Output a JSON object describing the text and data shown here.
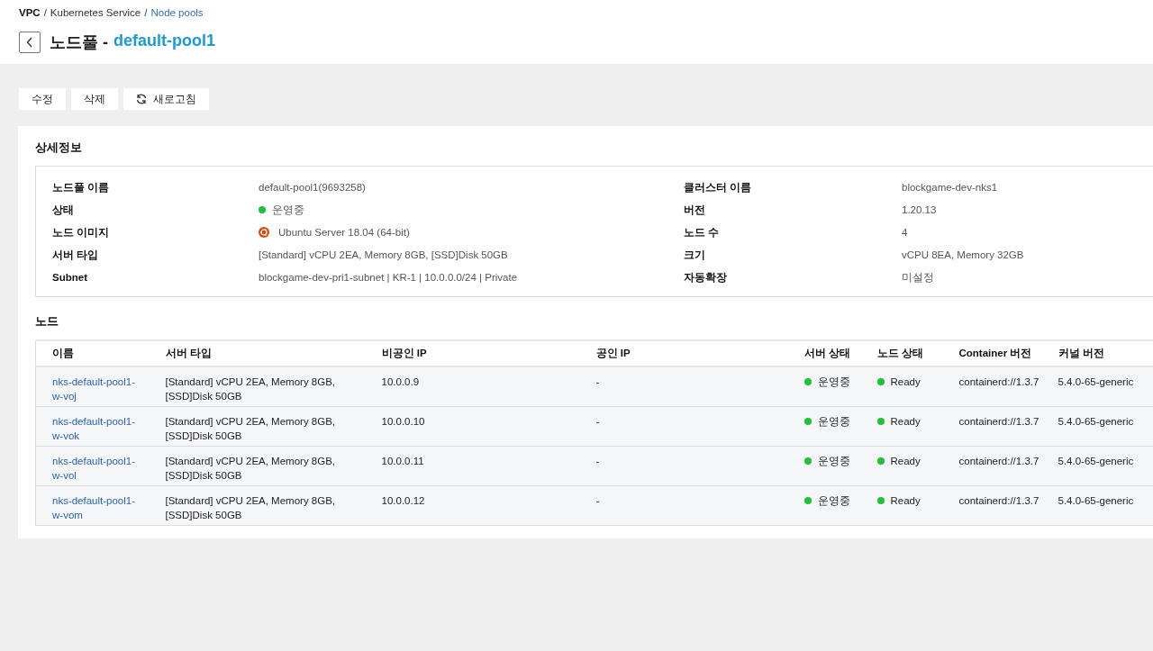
{
  "breadcrumb": [
    {
      "label": "VPC",
      "kind": "root",
      "separator": "/"
    },
    {
      "label": "Kubernetes Service",
      "kind": "text",
      "separator": "/"
    },
    {
      "label": "Node pools",
      "kind": "link"
    }
  ],
  "title": {
    "prefix": "노드풀 -",
    "name": "default-pool1"
  },
  "toolbar": [
    {
      "label": "수정",
      "kind": "plain"
    },
    {
      "label": "삭제",
      "kind": "plain"
    },
    {
      "label": "새로고침",
      "kind": "refresh"
    }
  ],
  "details": {
    "title": "상세정보",
    "left": [
      {
        "label": "노드풀 이름",
        "value": "default-pool1(9693258)",
        "kind": "text"
      },
      {
        "label": "상태",
        "value": "운영중",
        "kind": "status",
        "color": "#1ec337"
      },
      {
        "label": "노드 이미지",
        "value": "Ubuntu Server 18.04 (64-bit)",
        "kind": "os"
      },
      {
        "label": "서버 타입",
        "value": "[Standard] vCPU 2EA, Memory 8GB, [SSD]Disk 50GB",
        "kind": "text"
      },
      {
        "label": "Subnet",
        "value": "blockgame-dev-pri1-subnet | KR-1 | 10.0.0.0/24 | Private",
        "kind": "text"
      }
    ],
    "right": [
      {
        "label": "클러스터 이름",
        "value": "blockgame-dev-nks1",
        "kind": "text"
      },
      {
        "label": "버전",
        "value": "1.20.13",
        "kind": "text"
      },
      {
        "label": "노드 수",
        "value": "4",
        "kind": "text"
      },
      {
        "label": "크기",
        "value": "vCPU 8EA, Memory 32GB",
        "kind": "text"
      },
      {
        "label": "자동확장",
        "value": "미설정",
        "kind": "text"
      }
    ]
  },
  "nodes": {
    "title": "노드",
    "columns": [
      "이름",
      "서버 타입",
      "비공인 IP",
      "공인 IP",
      "서버 상태",
      "노드 상태",
      "Container 버전",
      "커널 버전"
    ],
    "rows": [
      {
        "name": "nks-default-pool1-w-voj",
        "server_type": "[Standard] vCPU 2EA, Memory 8GB, [SSD]Disk 50GB",
        "private_ip": "10.0.0.9",
        "public_ip": "-",
        "server_status": {
          "label": "운영중",
          "color": "#1ec337"
        },
        "node_status": {
          "label": "Ready",
          "color": "#1ec337"
        },
        "container_version": "containerd://1.3.7",
        "kernel_version": "5.4.0-65-generic"
      },
      {
        "name": "nks-default-pool1-w-vok",
        "server_type": "[Standard] vCPU 2EA, Memory 8GB, [SSD]Disk 50GB",
        "private_ip": "10.0.0.10",
        "public_ip": "-",
        "server_status": {
          "label": "운영중",
          "color": "#1ec337"
        },
        "node_status": {
          "label": "Ready",
          "color": "#1ec337"
        },
        "container_version": "containerd://1.3.7",
        "kernel_version": "5.4.0-65-generic"
      },
      {
        "name": "nks-default-pool1-w-vol",
        "server_type": "[Standard] vCPU 2EA, Memory 8GB, [SSD]Disk 50GB",
        "private_ip": "10.0.0.11",
        "public_ip": "-",
        "server_status": {
          "label": "운영중",
          "color": "#1ec337"
        },
        "node_status": {
          "label": "Ready",
          "color": "#1ec337"
        },
        "container_version": "containerd://1.3.7",
        "kernel_version": "5.4.0-65-generic"
      },
      {
        "name": "nks-default-pool1-w-vom",
        "server_type": "[Standard] vCPU 2EA, Memory 8GB, [SSD]Disk 50GB",
        "private_ip": "10.0.0.12",
        "public_ip": "-",
        "server_status": {
          "label": "운영중",
          "color": "#1ec337"
        },
        "node_status": {
          "label": "Ready",
          "color": "#1ec337"
        },
        "container_version": "containerd://1.3.7",
        "kernel_version": "5.4.0-65-generic"
      }
    ]
  }
}
